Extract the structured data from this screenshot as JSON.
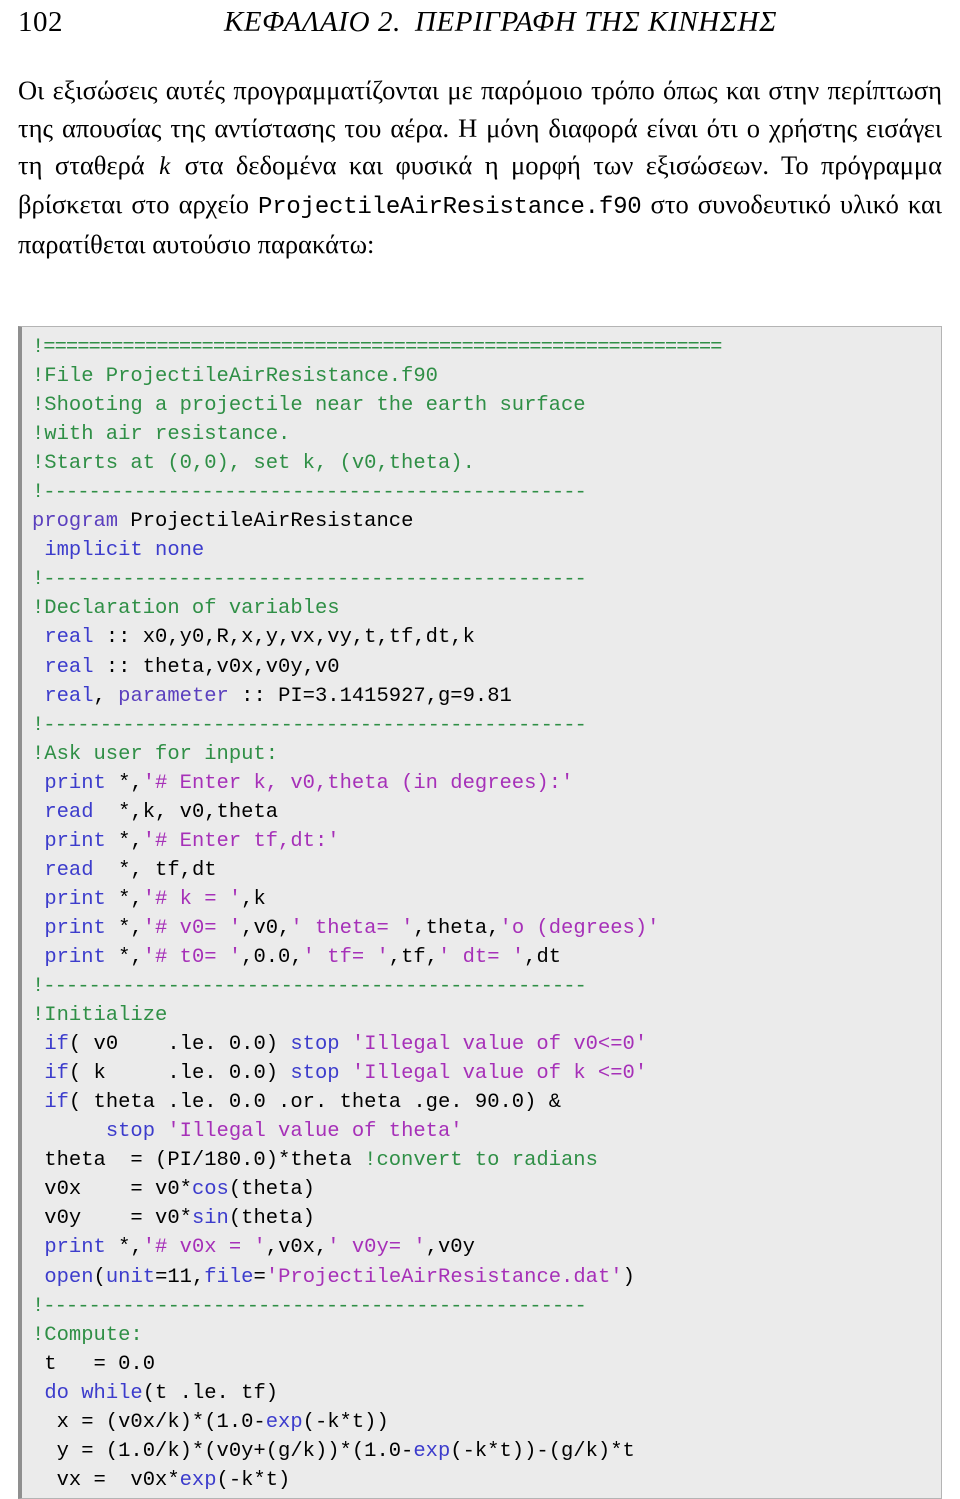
{
  "header": {
    "folio": "102",
    "chapter_title": "ΚΕΦΑΛΑΙΟ 2.",
    "chapter_subject": "ΠΕΡΙΓΡΑΦΗ ΤΗΣ ΚΙΝΗΣΗΣ"
  },
  "body": {
    "part1": "Οι εξισώσεις αυτές προγραμματίζονται με παρόμοιο τρόπο όπως και στην περίπτωση της απουσίας της αντίστασης του αέρα. Η μόνη διαφορά είναι ότι ο χρήστης εισάγει τη σταθερά ",
    "inline_math": "k",
    "part2": " στα δεδομένα και φυσικά η μορφή των εξισώσεων. Το πρόγραμμα βρίσκεται στο αρχείο ",
    "filename": "ProjectileAirResistance.f90",
    "part3": " στο συνοδευτικό υλικό και παρατίθεται αυτούσιο παρακάτω:"
  },
  "code": {
    "language": "fortran",
    "colors": {
      "comment": "#2f8f46",
      "keyword": "#3c3ccc",
      "string": "#a630b8",
      "plain": "#000000",
      "background": "#ebebeb",
      "border": "#8f8f8f"
    },
    "lines": [
      [
        {
          "t": "cmt",
          "s": "!============================================================"
        }
      ],
      [
        {
          "t": "cmt",
          "s": "!File ProjectileAirResistance.f90"
        }
      ],
      [
        {
          "t": "cmt",
          "s": "!Shooting a projectile near the earth surface"
        }
      ],
      [
        {
          "t": "cmt",
          "s": "!with air resistance."
        }
      ],
      [
        {
          "t": "cmt",
          "s": "!Starts at (0,0), set k, (v0,theta)."
        }
      ],
      [
        {
          "t": "cmt",
          "s": "!------------------------------------------------"
        }
      ],
      [
        {
          "t": "kw2",
          "s": "program"
        },
        {
          "t": "plain",
          "s": " ProjectileAirResistance"
        }
      ],
      [
        {
          "t": "plain",
          "s": " "
        },
        {
          "t": "kw",
          "s": "implicit none"
        }
      ],
      [
        {
          "t": "cmt",
          "s": "!------------------------------------------------"
        }
      ],
      [
        {
          "t": "cmt",
          "s": "!Declaration of variables"
        }
      ],
      [
        {
          "t": "plain",
          "s": " "
        },
        {
          "t": "kw",
          "s": "real"
        },
        {
          "t": "plain",
          "s": " :: x0,y0,R,x,y,vx,vy,t,tf,dt,k"
        }
      ],
      [
        {
          "t": "plain",
          "s": " "
        },
        {
          "t": "kw",
          "s": "real"
        },
        {
          "t": "plain",
          "s": " :: theta,v0x,v0y,v0"
        }
      ],
      [
        {
          "t": "plain",
          "s": " "
        },
        {
          "t": "kw",
          "s": "real"
        },
        {
          "t": "plain",
          "s": ", "
        },
        {
          "t": "kw2",
          "s": "parameter"
        },
        {
          "t": "plain",
          "s": " :: PI=3.1415927,g=9.81"
        }
      ],
      [
        {
          "t": "cmt",
          "s": "!------------------------------------------------"
        }
      ],
      [
        {
          "t": "cmt",
          "s": "!Ask user for input:"
        }
      ],
      [
        {
          "t": "plain",
          "s": " "
        },
        {
          "t": "kw",
          "s": "print"
        },
        {
          "t": "plain",
          "s": " *,"
        },
        {
          "t": "str",
          "s": "'# Enter k, v0,theta (in degrees):'"
        }
      ],
      [
        {
          "t": "plain",
          "s": " "
        },
        {
          "t": "kw",
          "s": "read"
        },
        {
          "t": "plain",
          "s": "  *,k, v0,theta"
        }
      ],
      [
        {
          "t": "plain",
          "s": " "
        },
        {
          "t": "kw",
          "s": "print"
        },
        {
          "t": "plain",
          "s": " *,"
        },
        {
          "t": "str",
          "s": "'# Enter tf,dt:'"
        }
      ],
      [
        {
          "t": "plain",
          "s": " "
        },
        {
          "t": "kw",
          "s": "read"
        },
        {
          "t": "plain",
          "s": "  *, tf,dt"
        }
      ],
      [
        {
          "t": "plain",
          "s": " "
        },
        {
          "t": "kw",
          "s": "print"
        },
        {
          "t": "plain",
          "s": " *,"
        },
        {
          "t": "str",
          "s": "'# k = '"
        },
        {
          "t": "plain",
          "s": ",k"
        }
      ],
      [
        {
          "t": "plain",
          "s": " "
        },
        {
          "t": "kw",
          "s": "print"
        },
        {
          "t": "plain",
          "s": " *,"
        },
        {
          "t": "str",
          "s": "'# v0= '"
        },
        {
          "t": "plain",
          "s": ",v0,"
        },
        {
          "t": "str",
          "s": "' theta= '"
        },
        {
          "t": "plain",
          "s": ",theta,"
        },
        {
          "t": "str",
          "s": "'o (degrees)'"
        }
      ],
      [
        {
          "t": "plain",
          "s": " "
        },
        {
          "t": "kw",
          "s": "print"
        },
        {
          "t": "plain",
          "s": " *,"
        },
        {
          "t": "str",
          "s": "'# t0= '"
        },
        {
          "t": "plain",
          "s": ",0.0,"
        },
        {
          "t": "str",
          "s": "' tf= '"
        },
        {
          "t": "plain",
          "s": ",tf,"
        },
        {
          "t": "str",
          "s": "' dt= '"
        },
        {
          "t": "plain",
          "s": ",dt"
        }
      ],
      [
        {
          "t": "cmt",
          "s": "!------------------------------------------------"
        }
      ],
      [
        {
          "t": "cmt",
          "s": "!Initialize"
        }
      ],
      [
        {
          "t": "plain",
          "s": " "
        },
        {
          "t": "kw",
          "s": "if"
        },
        {
          "t": "plain",
          "s": "( v0    .le. 0.0) "
        },
        {
          "t": "kw",
          "s": "stop"
        },
        {
          "t": "plain",
          "s": " "
        },
        {
          "t": "str",
          "s": "'Illegal value of v0<=0'"
        }
      ],
      [
        {
          "t": "plain",
          "s": " "
        },
        {
          "t": "kw",
          "s": "if"
        },
        {
          "t": "plain",
          "s": "( k     .le. 0.0) "
        },
        {
          "t": "kw",
          "s": "stop"
        },
        {
          "t": "plain",
          "s": " "
        },
        {
          "t": "str",
          "s": "'Illegal value of k <=0'"
        }
      ],
      [
        {
          "t": "plain",
          "s": " "
        },
        {
          "t": "kw",
          "s": "if"
        },
        {
          "t": "plain",
          "s": "( theta .le. 0.0 .or. theta .ge. 90.0) &"
        }
      ],
      [
        {
          "t": "plain",
          "s": "      "
        },
        {
          "t": "kw",
          "s": "stop"
        },
        {
          "t": "plain",
          "s": " "
        },
        {
          "t": "str",
          "s": "'Illegal value of theta'"
        }
      ],
      [
        {
          "t": "plain",
          "s": " theta  = (PI/180.0)*theta "
        },
        {
          "t": "cmt",
          "s": "!convert to radians"
        }
      ],
      [
        {
          "t": "plain",
          "s": " v0x    = v0*"
        },
        {
          "t": "kw",
          "s": "cos"
        },
        {
          "t": "plain",
          "s": "(theta)"
        }
      ],
      [
        {
          "t": "plain",
          "s": " v0y    = v0*"
        },
        {
          "t": "kw",
          "s": "sin"
        },
        {
          "t": "plain",
          "s": "(theta)"
        }
      ],
      [
        {
          "t": "plain",
          "s": " "
        },
        {
          "t": "kw",
          "s": "print"
        },
        {
          "t": "plain",
          "s": " *,"
        },
        {
          "t": "str",
          "s": "'# v0x = '"
        },
        {
          "t": "plain",
          "s": ",v0x,"
        },
        {
          "t": "str",
          "s": "' v0y= '"
        },
        {
          "t": "plain",
          "s": ",v0y"
        }
      ],
      [
        {
          "t": "plain",
          "s": " "
        },
        {
          "t": "kw",
          "s": "open"
        },
        {
          "t": "plain",
          "s": "("
        },
        {
          "t": "kw",
          "s": "unit"
        },
        {
          "t": "plain",
          "s": "=11,"
        },
        {
          "t": "kw",
          "s": "file"
        },
        {
          "t": "plain",
          "s": "="
        },
        {
          "t": "str",
          "s": "'ProjectileAirResistance.dat'"
        },
        {
          "t": "plain",
          "s": ")"
        }
      ],
      [
        {
          "t": "cmt",
          "s": "!------------------------------------------------"
        }
      ],
      [
        {
          "t": "cmt",
          "s": "!Compute:"
        }
      ],
      [
        {
          "t": "plain",
          "s": " t   = 0.0"
        }
      ],
      [
        {
          "t": "plain",
          "s": " "
        },
        {
          "t": "kw",
          "s": "do while"
        },
        {
          "t": "plain",
          "s": "(t .le. tf)"
        }
      ],
      [
        {
          "t": "plain",
          "s": "  x = (v0x/k)*(1.0-"
        },
        {
          "t": "kw",
          "s": "exp"
        },
        {
          "t": "plain",
          "s": "(-k*t))"
        }
      ],
      [
        {
          "t": "plain",
          "s": "  y = (1.0/k)*(v0y+(g/k))*(1.0-"
        },
        {
          "t": "kw",
          "s": "exp"
        },
        {
          "t": "plain",
          "s": "(-k*t))-(g/k)*t"
        }
      ],
      [
        {
          "t": "plain",
          "s": "  vx =  v0x*"
        },
        {
          "t": "kw",
          "s": "exp"
        },
        {
          "t": "plain",
          "s": "(-k*t)"
        }
      ]
    ]
  }
}
